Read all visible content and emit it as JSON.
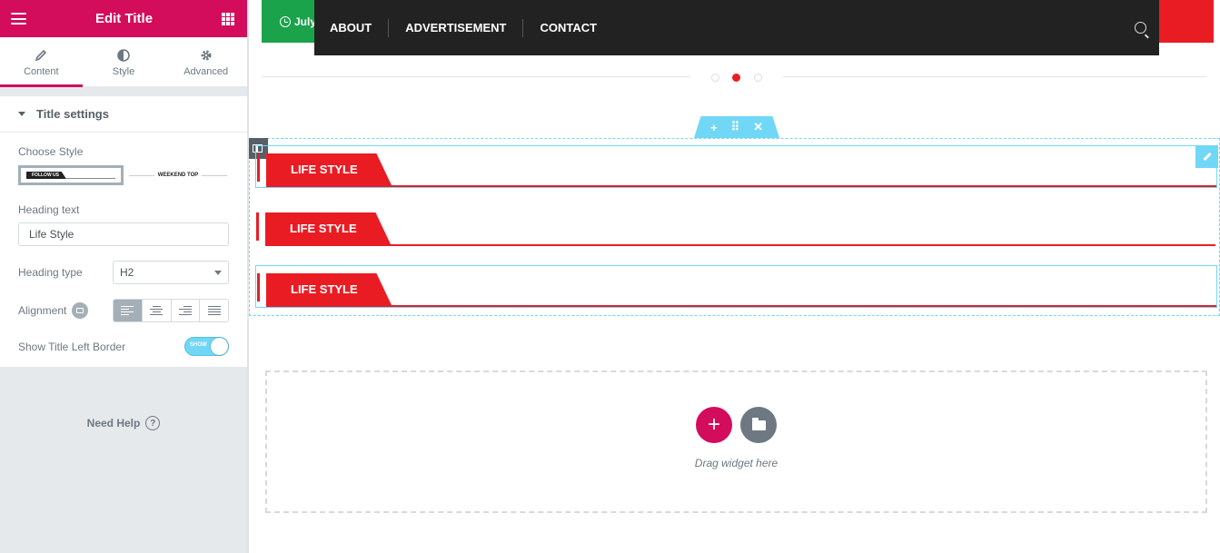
{
  "panel": {
    "title": "Edit Title",
    "tabs": [
      {
        "label": "Content",
        "icon": "pencil-icon"
      },
      {
        "label": "Style",
        "icon": "half-circle-icon"
      },
      {
        "label": "Advanced",
        "icon": "gear-icon"
      }
    ],
    "section_title": "Title settings",
    "choose_style_label": "Choose Style",
    "style_options": [
      {
        "preview_text": "FOLLOW US"
      },
      {
        "preview_text": "WEEKEND TOP"
      }
    ],
    "heading_text_label": "Heading text",
    "heading_text_value": "Life Style",
    "heading_type_label": "Heading type",
    "heading_type_value": "H2",
    "alignment_label": "Alignment",
    "show_border_label": "Show Title Left Border",
    "toggle_label": "SHOW",
    "need_help": "Need Help",
    "help_glyph": "?",
    "collapse_glyph": "‹",
    "accent_color": "#d30c5c"
  },
  "canvas": {
    "topbar_date": "July",
    "nav_items": [
      "ABOUT",
      "ADVERTISEMENT",
      "CONTACT"
    ],
    "section_handle": {
      "add": "+",
      "move": "⠿",
      "close": "✕"
    },
    "widgets": [
      {
        "label": "LIFE STYLE"
      },
      {
        "label": "LIFE STYLE"
      },
      {
        "label": "LIFE STYLE"
      }
    ],
    "dropzone": {
      "add_glyph": "+",
      "text": "Drag widget here"
    },
    "colors": {
      "nav_bg": "#222222",
      "title_red": "#e91c24",
      "topbar_green": "#1aa34a",
      "editor_blue": "#71d7f7"
    }
  }
}
